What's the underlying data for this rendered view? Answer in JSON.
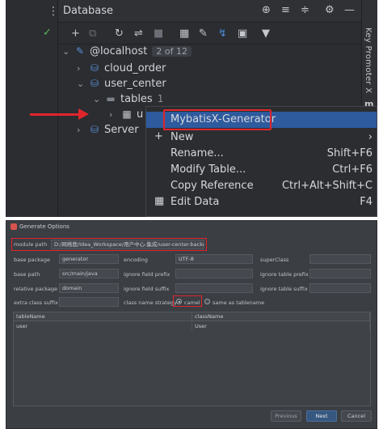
{
  "ide": {
    "tool_window_title": "Database",
    "side_tab_label": "Key Promoter X",
    "tree": {
      "root_label": "@localhost",
      "root_pill": "2 of 12",
      "db1": "cloud_order",
      "db2": "user_center",
      "tables_label": "tables",
      "tables_count": "1",
      "table_partial": "u",
      "server_label": "Server"
    },
    "context_menu": {
      "items": [
        {
          "label": "MybatisX-Generator",
          "shortcut": "",
          "icon": ""
        },
        {
          "label": "New",
          "shortcut": "›",
          "icon": "+"
        },
        {
          "label": "Rename...",
          "shortcut": "Shift+F6",
          "icon": ""
        },
        {
          "label": "Modify Table...",
          "shortcut": "Ctrl+F6",
          "icon": ""
        },
        {
          "label": "Copy Reference",
          "shortcut": "Ctrl+Alt+Shift+C",
          "icon": ""
        },
        {
          "label": "Edit Data",
          "shortcut": "F4",
          "icon": "grid"
        }
      ]
    },
    "colors": {
      "accent": "#2e5a9e",
      "highlight_red": "#e0262c"
    }
  },
  "dialog": {
    "title": "Generate Options",
    "module_path_label": "module path",
    "module_path_value": "D:/网络鹿/Idea_Workspace/用户中心-集成/user-center-backend",
    "base_package_label": "base package",
    "base_package_value": "generator",
    "encoding_label": "encoding",
    "encoding_value": "UTF-8",
    "superclass_label": "superClass",
    "superclass_value": "",
    "base_path_label": "base path",
    "base_path_value": "src/main/java",
    "ignore_field_prefix_label": "ignore field prefix",
    "ignore_field_prefix_value": "",
    "ignore_table_prefix_label": "ignore table prefix",
    "ignore_table_prefix_value": "",
    "relative_package_label": "relative package",
    "relative_package_value": "domain",
    "ignore_field_suffix_label": "ignore field suffix",
    "ignore_field_suffix_value": "",
    "ignore_table_suffix_label": "ignore table suffix",
    "ignore_table_suffix_value": "",
    "extra_class_suffix_label": "extra class suffix",
    "extra_class_suffix_value": "",
    "class_name_strategy_label": "class name strategy",
    "strategy_option_camel": "camel",
    "strategy_option_same": "same as tablename",
    "strategy_selected": "camel",
    "table": {
      "headers": [
        "tableName",
        "className"
      ],
      "rows": [
        [
          "user",
          "User"
        ]
      ]
    },
    "buttons": {
      "previous": "Previous",
      "next": "Next",
      "cancel": "Cancel"
    }
  }
}
